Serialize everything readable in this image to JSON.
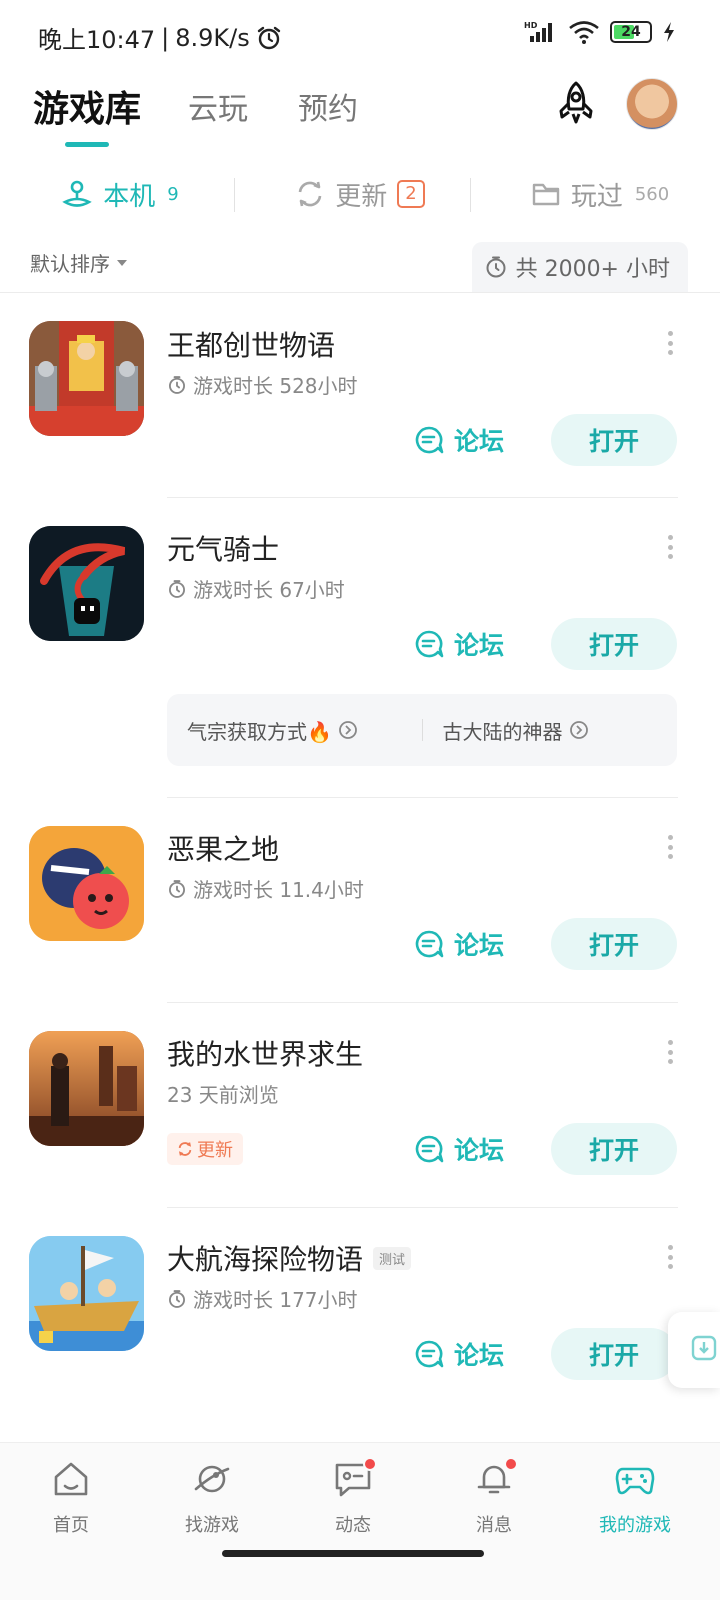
{
  "status_bar": {
    "time": "晚上10:47",
    "speed": "8.9K/s",
    "battery": "24",
    "network": "HD"
  },
  "top_tabs": [
    {
      "label": "游戏库",
      "active": true
    },
    {
      "label": "云玩",
      "active": false
    },
    {
      "label": "预约",
      "active": false
    }
  ],
  "sub_tabs": {
    "local": {
      "label": "本机",
      "count": "9"
    },
    "updates": {
      "label": "更新",
      "count": "2"
    },
    "played": {
      "label": "玩过",
      "count": "560"
    }
  },
  "sort": {
    "label": "默认排序",
    "total": "共 2000+ 小时"
  },
  "games": [
    {
      "name": "王都创世物语",
      "meta": "游戏时长 528小时",
      "forum": "论坛",
      "open": "打开"
    },
    {
      "name": "元气骑士",
      "meta": "游戏时长 67小时",
      "forum": "论坛",
      "open": "打开",
      "strategies": [
        "气宗获取方式🔥",
        "古大陆的神器"
      ]
    },
    {
      "name": "恶果之地",
      "meta": "游戏时长 11.4小时",
      "forum": "论坛",
      "open": "打开"
    },
    {
      "name": "我的水世界求生",
      "meta": "23 天前浏览",
      "forum": "论坛",
      "open": "打开",
      "update_tag": "更新"
    },
    {
      "name": "大航海探险物语",
      "tag": "测试",
      "meta": "游戏时长 177小时",
      "forum": "论坛",
      "open": "打开"
    }
  ],
  "bottom_nav": [
    {
      "label": "首页",
      "icon": "home-icon"
    },
    {
      "label": "找游戏",
      "icon": "planet-icon"
    },
    {
      "label": "动态",
      "icon": "chat-icon",
      "dot": true
    },
    {
      "label": "消息",
      "icon": "bell-icon",
      "dot": true
    },
    {
      "label": "我的游戏",
      "icon": "gamepad-icon",
      "active": true
    }
  ],
  "colors": {
    "accent": "#1fb8b6",
    "update": "#ef7a54",
    "badge_dot": "#f24a4a"
  }
}
